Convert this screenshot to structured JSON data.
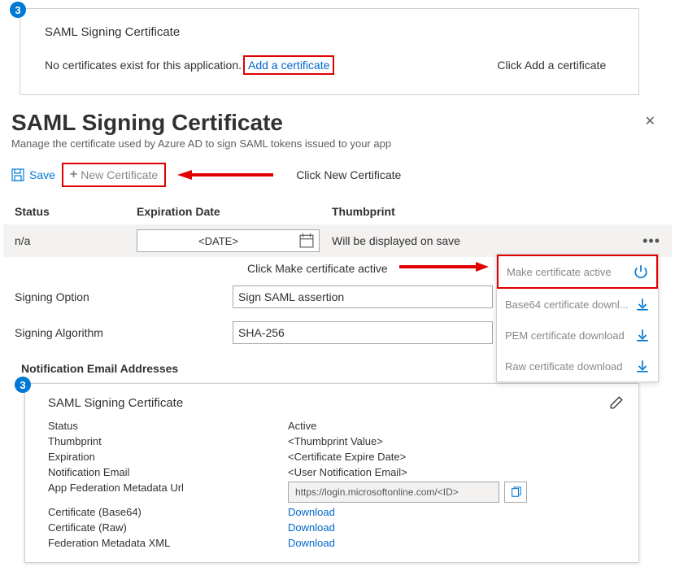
{
  "step3": {
    "badge": "3",
    "card_title": "SAML Signing Certificate",
    "no_cert_msg": "No certificates exist for this application.",
    "add_link": "Add a certificate",
    "instruction": "Click Add a certificate"
  },
  "panel": {
    "title": "SAML Signing Certificate",
    "subtitle": "Manage the certificate used by Azure AD to sign SAML tokens issued to your app",
    "close": "✕"
  },
  "toolbar": {
    "save_label": "Save",
    "newcert_label": "New Certificate",
    "instruction": "Click New Certificate"
  },
  "table": {
    "head_status": "Status",
    "head_exp": "Expiration Date",
    "head_thumb": "Thumbprint",
    "row_status": "n/a",
    "row_date": "<DATE>",
    "row_thumb": "Will be displayed on save"
  },
  "mid_instruction": "Click Make certificate active",
  "menu": {
    "make_active": "Make certificate active",
    "b64": "Base64 certificate downl...",
    "pem": "PEM certificate download",
    "raw": "Raw certificate download"
  },
  "form": {
    "signopt_label": "Signing Option",
    "signopt_value": "Sign SAML assertion",
    "algo_label": "Signing Algorithm",
    "algo_value": "SHA-256",
    "notif_label": "Notification Email Addresses"
  },
  "details": {
    "badge": "3",
    "title": "SAML Signing Certificate",
    "status_k": "Status",
    "status_v": "Active",
    "thumb_k": "Thumbprint",
    "thumb_v": "<Thumbprint Value>",
    "exp_k": "Expiration",
    "exp_v": "<Certificate Expire Date>",
    "notif_k": "Notification Email",
    "notif_v": "<User Notification Email>",
    "url_k": "App Federation Metadata Url",
    "url_v": "https://login.microsoftonline.com/<ID>",
    "cert64_k": "Certificate (Base64)",
    "certraw_k": "Certificate (Raw)",
    "fedxml_k": "Federation Metadata XML",
    "download": "Download"
  }
}
